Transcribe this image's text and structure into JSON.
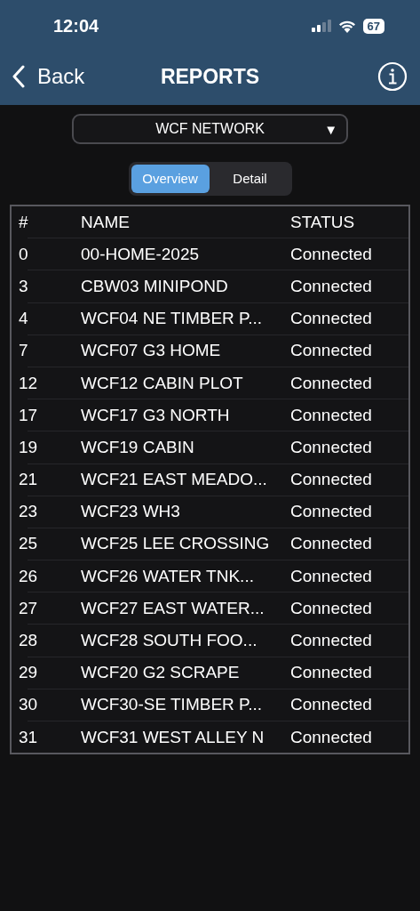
{
  "status_bar": {
    "time": "12:04",
    "battery": "67"
  },
  "nav": {
    "back": "Back",
    "title": "REPORTS"
  },
  "network_select": {
    "value": "WCF NETWORK",
    "caret": "▼"
  },
  "segments": [
    {
      "label": "Overview",
      "selected": true
    },
    {
      "label": "Detail",
      "selected": false
    }
  ],
  "table": {
    "columns": [
      "#",
      "NAME",
      "STATUS"
    ],
    "rows": [
      {
        "num": "0",
        "name": "00-HOME-2025",
        "status": "Connected"
      },
      {
        "num": "3",
        "name": "CBW03 MINIPOND",
        "status": "Connected"
      },
      {
        "num": "4",
        "name": "WCF04 NE TIMBER P...",
        "status": "Connected"
      },
      {
        "num": "7",
        "name": "WCF07 G3 HOME",
        "status": "Connected"
      },
      {
        "num": "12",
        "name": "WCF12 CABIN PLOT",
        "status": "Connected"
      },
      {
        "num": "17",
        "name": "WCF17 G3 NORTH",
        "status": "Connected"
      },
      {
        "num": "19",
        "name": "WCF19 CABIN",
        "status": "Connected"
      },
      {
        "num": "21",
        "name": "WCF21 EAST MEADO...",
        "status": "Connected"
      },
      {
        "num": "23",
        "name": "WCF23 WH3",
        "status": "Connected"
      },
      {
        "num": "25",
        "name": "WCF25 LEE CROSSING",
        "status": "Connected"
      },
      {
        "num": "26",
        "name": "WCF26 WATER TNK...",
        "status": "Connected"
      },
      {
        "num": "27",
        "name": "WCF27 EAST WATER...",
        "status": "Connected"
      },
      {
        "num": "28",
        "name": "WCF28 SOUTH FOO...",
        "status": "Connected"
      },
      {
        "num": "29",
        "name": "WCF20 G2 SCRAPE",
        "status": "Connected"
      },
      {
        "num": "30",
        "name": "WCF30-SE TIMBER P...",
        "status": "Connected"
      },
      {
        "num": "31",
        "name": "WCF31 WEST ALLEY N",
        "status": "Connected"
      }
    ]
  }
}
